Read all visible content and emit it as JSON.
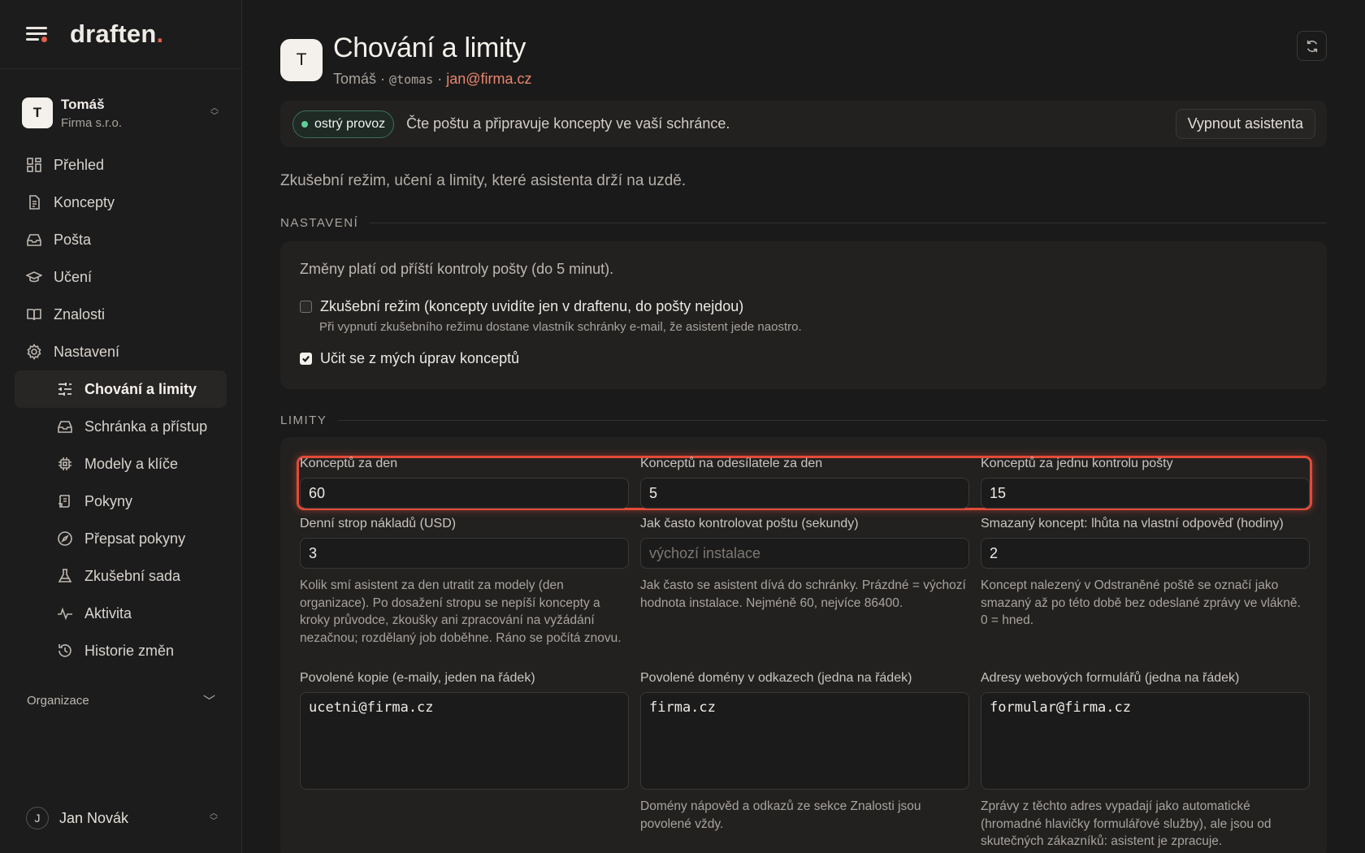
{
  "brand": {
    "name": "draften",
    "dot": "."
  },
  "org_switcher": {
    "avatar": "T",
    "name": "Tomáš",
    "subtitle": "Firma s.r.o."
  },
  "nav": {
    "items": [
      {
        "label": "Přehled",
        "icon": "dashboard-icon"
      },
      {
        "label": "Koncepty",
        "icon": "document-icon"
      },
      {
        "label": "Pošta",
        "icon": "inbox-icon"
      },
      {
        "label": "Učení",
        "icon": "graduation-cap-icon"
      },
      {
        "label": "Znalosti",
        "icon": "book-icon"
      },
      {
        "label": "Nastavení",
        "icon": "gear-icon"
      }
    ],
    "subitems": [
      {
        "label": "Chování a limity",
        "icon": "sliders-icon",
        "active": true
      },
      {
        "label": "Schránka a přístup",
        "icon": "inbox-icon"
      },
      {
        "label": "Modely a klíče",
        "icon": "chip-icon"
      },
      {
        "label": "Pokyny",
        "icon": "scroll-icon"
      },
      {
        "label": "Přepsat pokyny",
        "icon": "compass-icon"
      },
      {
        "label": "Zkušební sada",
        "icon": "flask-icon"
      },
      {
        "label": "Aktivita",
        "icon": "activity-icon"
      },
      {
        "label": "Historie změn",
        "icon": "history-icon"
      }
    ],
    "org_section": "Organizace"
  },
  "user": {
    "initial": "J",
    "name": "Jan Novák"
  },
  "header": {
    "avatar": "T",
    "title": "Chování a limity",
    "name": "Tomáš",
    "separator": "·",
    "handle": "@tomas",
    "email": "jan@firma.cz"
  },
  "status": {
    "badge": "ostrý provoz",
    "text": "Čte poštu a připravuje koncepty ve vaší schránce.",
    "button": "Vypnout asistenta"
  },
  "intro": "Zkušební režim, učení a limity, které asistenta drží na uzdě.",
  "settings": {
    "section": "NASTAVENÍ",
    "note": "Změny platí od příští kontroly pošty (do 5 minut).",
    "trial_mode": {
      "label": "Zkušební režim (koncepty uvidíte jen v draftenu, do pošty nejdou)",
      "help": "Při vypnutí zkušebního režimu dostane vlastník schránky e-mail, že asistent jede naostro.",
      "checked": false
    },
    "learn": {
      "label": "Učit se z mých úprav konceptů",
      "checked": true
    }
  },
  "limits": {
    "section": "LIMITY",
    "drafts_per_day": {
      "label": "Konceptů za den",
      "value": "60"
    },
    "drafts_per_sender": {
      "label": "Konceptů na odesílatele za den",
      "value": "5"
    },
    "drafts_per_check": {
      "label": "Konceptů za jednu kontrolu pošty",
      "value": "15"
    },
    "daily_cost": {
      "label": "Denní strop nákladů (USD)",
      "value": "3",
      "help": "Kolik smí asistent za den utratit za modely (den organizace). Po dosažení stropu se nepíší koncepty a kroky průvodce, zkoušky ani zpracování na vyžádání nezačnou; rozdělaný job doběhne. Ráno se počítá znovu."
    },
    "check_interval": {
      "label": "Jak často kontrolovat poštu (sekundy)",
      "placeholder": "výchozí instalace",
      "help": "Jak často se asistent dívá do schránky. Prázdné = výchozí hodnota instalace. Nejméně 60, nejvíce 86400."
    },
    "deleted_grace": {
      "label": "Smazaný koncept: lhůta na vlastní odpověď (hodiny)",
      "value": "2",
      "help": "Koncept nalezený v Odstraněné poště se označí jako smazaný až po této době bez odeslané zprávy ve vlákně. 0 = hned."
    },
    "allowed_cc": {
      "label": "Povolené kopie (e-maily, jeden na řádek)",
      "value": "ucetni@firma.cz"
    },
    "allowed_domains": {
      "label": "Povolené domény v odkazech (jedna na řádek)",
      "value": "firma.cz",
      "help": "Domény nápověd a odkazů ze sekce Znalosti jsou povolené vždy."
    },
    "web_forms": {
      "label": "Adresy webových formulářů (jedna na řádek)",
      "value": "formular@firma.cz",
      "help": "Zprávy z těchto adres vypadají jako automatické (hromadné hlavičky formulářové služby), ale jsou od skutečných zákazníků: asistent je zpracuje."
    }
  }
}
